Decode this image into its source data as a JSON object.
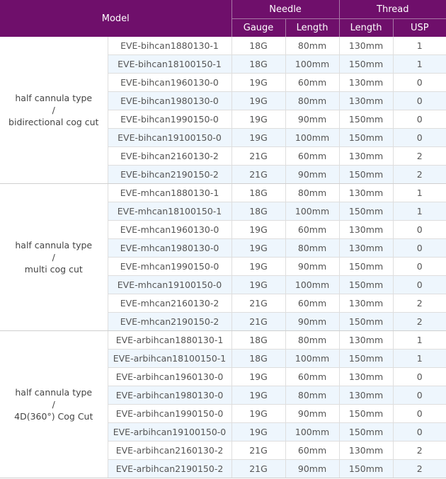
{
  "header": {
    "model": "Model",
    "needle": "Needle",
    "thread": "Thread",
    "gauge": "Gauge",
    "needle_length": "Length",
    "thread_length": "Length",
    "usp": "USP"
  },
  "groups": [
    {
      "type_line1": "half cannula type",
      "type_line2": "/",
      "type_line3": "bidirectional cog cut",
      "rows": [
        {
          "model": "EVE-bihcan1880130-1",
          "gauge": "18G",
          "needle_length": "80mm",
          "thread_length": "130mm",
          "usp": "1"
        },
        {
          "model": "EVE-bihcan18100150-1",
          "gauge": "18G",
          "needle_length": "100mm",
          "thread_length": "150mm",
          "usp": "1"
        },
        {
          "model": "EVE-bihcan1960130-0",
          "gauge": "19G",
          "needle_length": "60mm",
          "thread_length": "130mm",
          "usp": "0"
        },
        {
          "model": "EVE-bihcan1980130-0",
          "gauge": "19G",
          "needle_length": "80mm",
          "thread_length": "130mm",
          "usp": "0"
        },
        {
          "model": "EVE-bihcan1990150-0",
          "gauge": "19G",
          "needle_length": "90mm",
          "thread_length": "150mm",
          "usp": "0"
        },
        {
          "model": "EVE-bihcan19100150-0",
          "gauge": "19G",
          "needle_length": "100mm",
          "thread_length": "150mm",
          "usp": "0"
        },
        {
          "model": "EVE-bihcan2160130-2",
          "gauge": "21G",
          "needle_length": "60mm",
          "thread_length": "130mm",
          "usp": "2"
        },
        {
          "model": "EVE-bihcan2190150-2",
          "gauge": "21G",
          "needle_length": "90mm",
          "thread_length": "150mm",
          "usp": "2"
        }
      ]
    },
    {
      "type_line1": "half cannula type",
      "type_line2": "/",
      "type_line3": "multi cog cut",
      "rows": [
        {
          "model": "EVE-mhcan1880130-1",
          "gauge": "18G",
          "needle_length": "80mm",
          "thread_length": "130mm",
          "usp": "1"
        },
        {
          "model": "EVE-mhcan18100150-1",
          "gauge": "18G",
          "needle_length": "100mm",
          "thread_length": "150mm",
          "usp": "1"
        },
        {
          "model": "EVE-mhcan1960130-0",
          "gauge": "19G",
          "needle_length": "60mm",
          "thread_length": "130mm",
          "usp": "0"
        },
        {
          "model": "EVE-mhcan1980130-0",
          "gauge": "19G",
          "needle_length": "80mm",
          "thread_length": "130mm",
          "usp": "0"
        },
        {
          "model": "EVE-mhcan1990150-0",
          "gauge": "19G",
          "needle_length": "90mm",
          "thread_length": "150mm",
          "usp": "0"
        },
        {
          "model": "EVE-mhcan19100150-0",
          "gauge": "19G",
          "needle_length": "100mm",
          "thread_length": "150mm",
          "usp": "0"
        },
        {
          "model": "EVE-mhcan2160130-2",
          "gauge": "21G",
          "needle_length": "60mm",
          "thread_length": "130mm",
          "usp": "2"
        },
        {
          "model": "EVE-mhcan2190150-2",
          "gauge": "21G",
          "needle_length": "90mm",
          "thread_length": "150mm",
          "usp": "2"
        }
      ]
    },
    {
      "type_line1": "half cannula type",
      "type_line2": "/",
      "type_line3": "4D(360°) Cog Cut",
      "rows": [
        {
          "model": "EVE-arbihcan1880130-1",
          "gauge": "18G",
          "needle_length": "80mm",
          "thread_length": "130mm",
          "usp": "1"
        },
        {
          "model": "EVE-arbihcan18100150-1",
          "gauge": "18G",
          "needle_length": "100mm",
          "thread_length": "150mm",
          "usp": "1"
        },
        {
          "model": "EVE-arbihcan1960130-0",
          "gauge": "19G",
          "needle_length": "60mm",
          "thread_length": "130mm",
          "usp": "0"
        },
        {
          "model": "EVE-arbihcan1980130-0",
          "gauge": "19G",
          "needle_length": "80mm",
          "thread_length": "130mm",
          "usp": "0"
        },
        {
          "model": "EVE-arbihcan1990150-0",
          "gauge": "19G",
          "needle_length": "90mm",
          "thread_length": "150mm",
          "usp": "0"
        },
        {
          "model": "EVE-arbihcan19100150-0",
          "gauge": "19G",
          "needle_length": "100mm",
          "thread_length": "150mm",
          "usp": "0"
        },
        {
          "model": "EVE-arbihcan2160130-2",
          "gauge": "21G",
          "needle_length": "60mm",
          "thread_length": "130mm",
          "usp": "2"
        },
        {
          "model": "EVE-arbihcan2190150-2",
          "gauge": "21G",
          "needle_length": "90mm",
          "thread_length": "150mm",
          "usp": "2"
        }
      ]
    }
  ]
}
